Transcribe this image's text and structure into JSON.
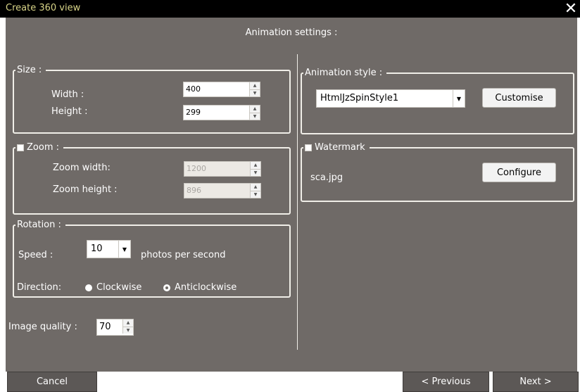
{
  "window": {
    "title": "Create 360 view",
    "close_icon": "close-icon"
  },
  "heading": "Animation settings :",
  "size": {
    "legend": "Size :",
    "width_label": "Width :",
    "width_value": "400",
    "height_label": "Height :",
    "height_value": "299"
  },
  "zoom": {
    "legend": "Zoom :",
    "checked": false,
    "width_label": "Zoom width:",
    "width_value": "1200",
    "height_label": "Zoom height :",
    "height_value": "896"
  },
  "rotation": {
    "legend": "Rotation :",
    "speed_label": "Speed :",
    "speed_value": "10",
    "speed_unit": "photos per second",
    "direction_label": "Direction:",
    "clockwise_label": "Clockwise",
    "anticlockwise_label": "Anticlockwise",
    "selected_direction": "Anticlockwise"
  },
  "quality": {
    "label": "Image quality :",
    "value": "70"
  },
  "animation_style": {
    "legend": "Animation style :",
    "selected": "HtmlJzSpinStyle1",
    "customise_label": "Customise"
  },
  "watermark": {
    "legend": "Watermark",
    "checked": false,
    "filename": "sca.jpg",
    "configure_label": "Configure"
  },
  "footer": {
    "cancel_label": "Cancel",
    "previous_label": "< Previous",
    "next_label": "Next >"
  },
  "colors": {
    "panel_bg": "#6f6a67",
    "titlebar_bg": "#000000",
    "title_text": "#d8d488",
    "button_dark": "#5c5856"
  }
}
